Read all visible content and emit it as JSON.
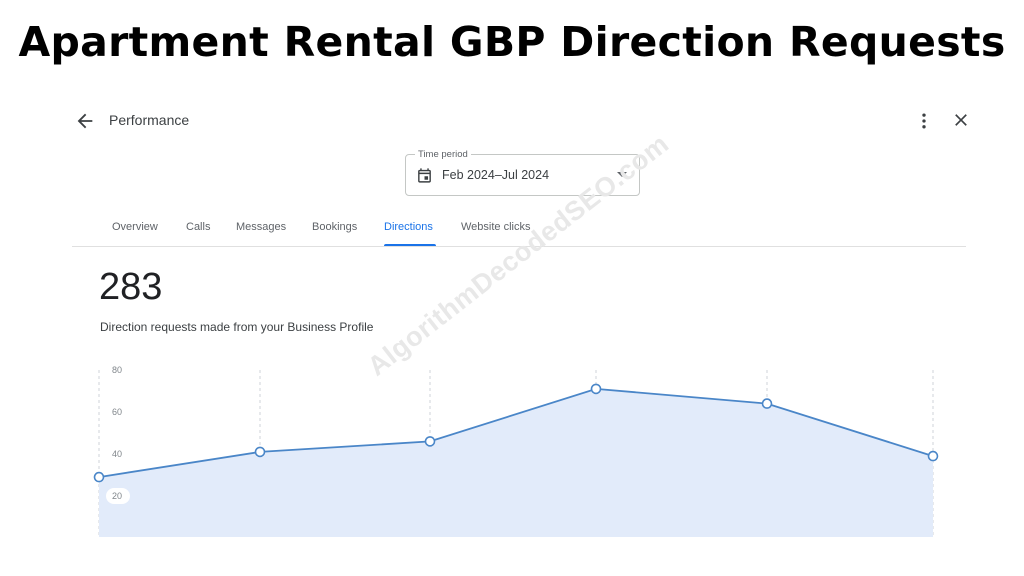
{
  "heading": "Apartment Rental GBP Direction Requests",
  "topbar": {
    "title": "Performance",
    "back_icon": "arrow-back-icon",
    "more_icon": "more-vert-icon",
    "close_icon": "close-icon"
  },
  "time_period": {
    "label": "Time period",
    "value": "Feb 2024–Jul 2024",
    "calendar_icon": "calendar-icon",
    "dropdown_icon": "caret-down-icon"
  },
  "tabs": [
    {
      "label": "Overview",
      "active": false
    },
    {
      "label": "Calls",
      "active": false
    },
    {
      "label": "Messages",
      "active": false
    },
    {
      "label": "Bookings",
      "active": false
    },
    {
      "label": "Directions",
      "active": true
    },
    {
      "label": "Website clicks",
      "active": false
    }
  ],
  "metric": {
    "value": "283",
    "caption": "Direction requests made from your Business Profile"
  },
  "watermark": "AlgorithmDecodedSEO.com",
  "colors": {
    "accent": "#1a73e8",
    "line": "#4a86c8",
    "area": "#e2ebfa"
  },
  "chart_data": {
    "type": "area",
    "x": [
      1,
      2,
      3,
      4,
      5,
      6
    ],
    "values": [
      29,
      41,
      46,
      71,
      64,
      39
    ],
    "ylim": [
      0,
      80
    ],
    "yticks": [
      80,
      60,
      40,
      20
    ],
    "grid": "vertical-dashed",
    "markers": "hollow-circle",
    "xlabel": "",
    "ylabel": ""
  }
}
